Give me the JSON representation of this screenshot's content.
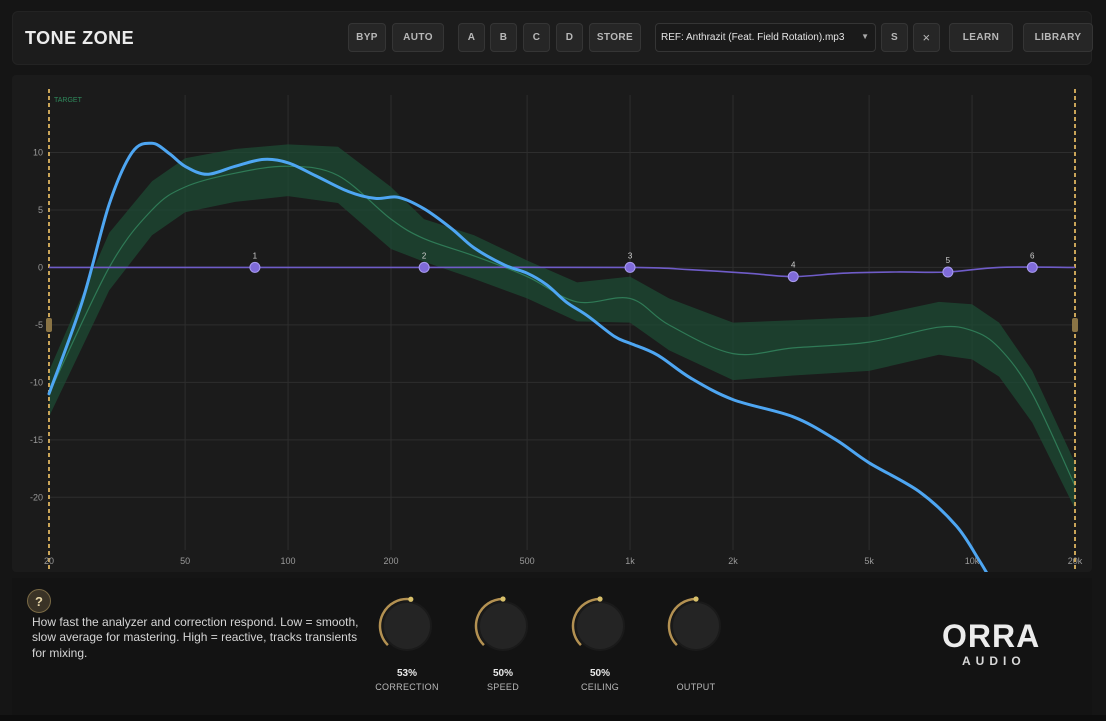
{
  "app": {
    "title": "TONE ZONE"
  },
  "toolbar": {
    "bypass": "BYP",
    "auto": "AUTO",
    "slot_a": "A",
    "slot_b": "B",
    "slot_c": "C",
    "slot_d": "D",
    "store": "STORE",
    "reference_file": "REF: Anthrazit (Feat. Field Rotation).mp3",
    "solo": "S",
    "clear": "×",
    "learn": "LEARN",
    "library": "LIBRARY"
  },
  "graph": {
    "target_label": "TARGET",
    "y_ticks": [
      "10",
      "5",
      "0",
      "-5",
      "-10",
      "-15",
      "-20"
    ],
    "y_tick_values": [
      10,
      5,
      0,
      -5,
      -10,
      -15,
      -20
    ],
    "x_ticks": [
      "20",
      "50",
      "100",
      "200",
      "500",
      "1k",
      "2k",
      "5k",
      "10k",
      "20k"
    ],
    "x_tick_values": [
      20,
      50,
      100,
      200,
      500,
      1000,
      2000,
      5000,
      10000,
      20000
    ],
    "x_range_hz": [
      20,
      20000
    ],
    "y_range_db": [
      -26.5,
      15
    ],
    "colors": {
      "analysis": "#4ea6f2",
      "target_band": "#1d4b34",
      "target_line": "#2f7a56",
      "correction": "#6f5cc8",
      "node": "#7f6bd9",
      "limit": "#c9a458",
      "grid": "#2e2e2e"
    },
    "analysis_curve": [
      [
        20,
        -11
      ],
      [
        25,
        -3
      ],
      [
        30,
        5.5
      ],
      [
        35,
        10
      ],
      [
        40,
        10.8
      ],
      [
        45,
        9.9
      ],
      [
        50,
        8.8
      ],
      [
        58,
        8.1
      ],
      [
        70,
        8.8
      ],
      [
        85,
        9.4
      ],
      [
        100,
        9.1
      ],
      [
        120,
        8
      ],
      [
        150,
        6.6
      ],
      [
        180,
        6
      ],
      [
        210,
        6.1
      ],
      [
        250,
        5.1
      ],
      [
        300,
        3.4
      ],
      [
        350,
        1.7
      ],
      [
        430,
        0.2
      ],
      [
        500,
        -0.5
      ],
      [
        570,
        -1.5
      ],
      [
        650,
        -3
      ],
      [
        750,
        -4.2
      ],
      [
        900,
        -6
      ],
      [
        1000,
        -6.6
      ],
      [
        1200,
        -7.6
      ],
      [
        1500,
        -9.6
      ],
      [
        2000,
        -11.5
      ],
      [
        3000,
        -13
      ],
      [
        4000,
        -15
      ],
      [
        5000,
        -17
      ],
      [
        7000,
        -19.5
      ],
      [
        9000,
        -22.5
      ],
      [
        10500,
        -25.5
      ],
      [
        11500,
        -27.5
      ]
    ],
    "target_center": [
      [
        20,
        -11
      ],
      [
        30,
        0
      ],
      [
        40,
        5
      ],
      [
        50,
        7
      ],
      [
        70,
        8.2
      ],
      [
        100,
        8.8
      ],
      [
        140,
        8
      ],
      [
        200,
        4.2
      ],
      [
        250,
        2.5
      ],
      [
        350,
        1
      ],
      [
        500,
        -0.8
      ],
      [
        700,
        -3
      ],
      [
        1000,
        -2.7
      ],
      [
        1300,
        -5
      ],
      [
        2000,
        -7.5
      ],
      [
        3000,
        -7
      ],
      [
        5000,
        -6.5
      ],
      [
        8000,
        -5.2
      ],
      [
        10000,
        -5.5
      ],
      [
        12000,
        -7
      ],
      [
        15000,
        -11
      ],
      [
        20000,
        -19
      ]
    ],
    "target_upper": [
      [
        20,
        -9
      ],
      [
        30,
        3
      ],
      [
        40,
        7.5
      ],
      [
        50,
        9.5
      ],
      [
        70,
        10.3
      ],
      [
        100,
        10.7
      ],
      [
        140,
        10.5
      ],
      [
        200,
        7
      ],
      [
        250,
        4.2
      ],
      [
        350,
        2.8
      ],
      [
        500,
        0.6
      ],
      [
        700,
        -1.3
      ],
      [
        1000,
        -0.8
      ],
      [
        1300,
        -2.7
      ],
      [
        2000,
        -4.8
      ],
      [
        3000,
        -4.6
      ],
      [
        5000,
        -4.3
      ],
      [
        8000,
        -3
      ],
      [
        10000,
        -3.2
      ],
      [
        12000,
        -4.8
      ],
      [
        15000,
        -9
      ],
      [
        20000,
        -17
      ]
    ],
    "target_lower": [
      [
        20,
        -13
      ],
      [
        30,
        -2
      ],
      [
        40,
        2.8
      ],
      [
        50,
        4.8
      ],
      [
        70,
        5.7
      ],
      [
        100,
        6.2
      ],
      [
        140,
        5.6
      ],
      [
        200,
        1.6
      ],
      [
        250,
        0.5
      ],
      [
        350,
        -1
      ],
      [
        500,
        -2.7
      ],
      [
        700,
        -4.7
      ],
      [
        1000,
        -4.8
      ],
      [
        1300,
        -7.2
      ],
      [
        2000,
        -9.8
      ],
      [
        3000,
        -9.4
      ],
      [
        5000,
        -9
      ],
      [
        8000,
        -7.6
      ],
      [
        10000,
        -8
      ],
      [
        12000,
        -9.5
      ],
      [
        15000,
        -13.5
      ],
      [
        20000,
        -21
      ]
    ],
    "correction_curve": [
      [
        20,
        0
      ],
      [
        80,
        0
      ],
      [
        250,
        0
      ],
      [
        1000,
        0
      ],
      [
        1500,
        -0.2
      ],
      [
        2200,
        -0.5
      ],
      [
        3000,
        -0.8
      ],
      [
        4200,
        -0.5
      ],
      [
        6000,
        -0.4
      ],
      [
        8500,
        -0.4
      ],
      [
        12000,
        0
      ],
      [
        20000,
        0
      ]
    ],
    "nodes": [
      {
        "label": "1",
        "freq": 80,
        "gain": 0
      },
      {
        "label": "2",
        "freq": 250,
        "gain": 0
      },
      {
        "label": "3",
        "freq": 1000,
        "gain": 0
      },
      {
        "label": "4",
        "freq": 3000,
        "gain": -0.8
      },
      {
        "label": "5",
        "freq": 8500,
        "gain": -0.4
      },
      {
        "label": "6",
        "freq": 15000,
        "gain": 0
      }
    ]
  },
  "help": {
    "icon": "?",
    "text": "How fast the analyzer and correction respond. Low = smooth, slow average for mastering. High = reactive, tracks transients for mixing."
  },
  "knobs": [
    {
      "label": "CORRECTION",
      "value_text": "53%",
      "value": 0.53
    },
    {
      "label": "SPEED",
      "value_text": "50%",
      "value": 0.5
    },
    {
      "label": "CEILING",
      "value_text": "50%",
      "value": 0.5
    },
    {
      "label": "OUTPUT",
      "value_text": "",
      "value": 0.5
    }
  ],
  "logo": {
    "main": "ORRA",
    "sub": "AUDIO",
    "accent": "#c79a45"
  }
}
